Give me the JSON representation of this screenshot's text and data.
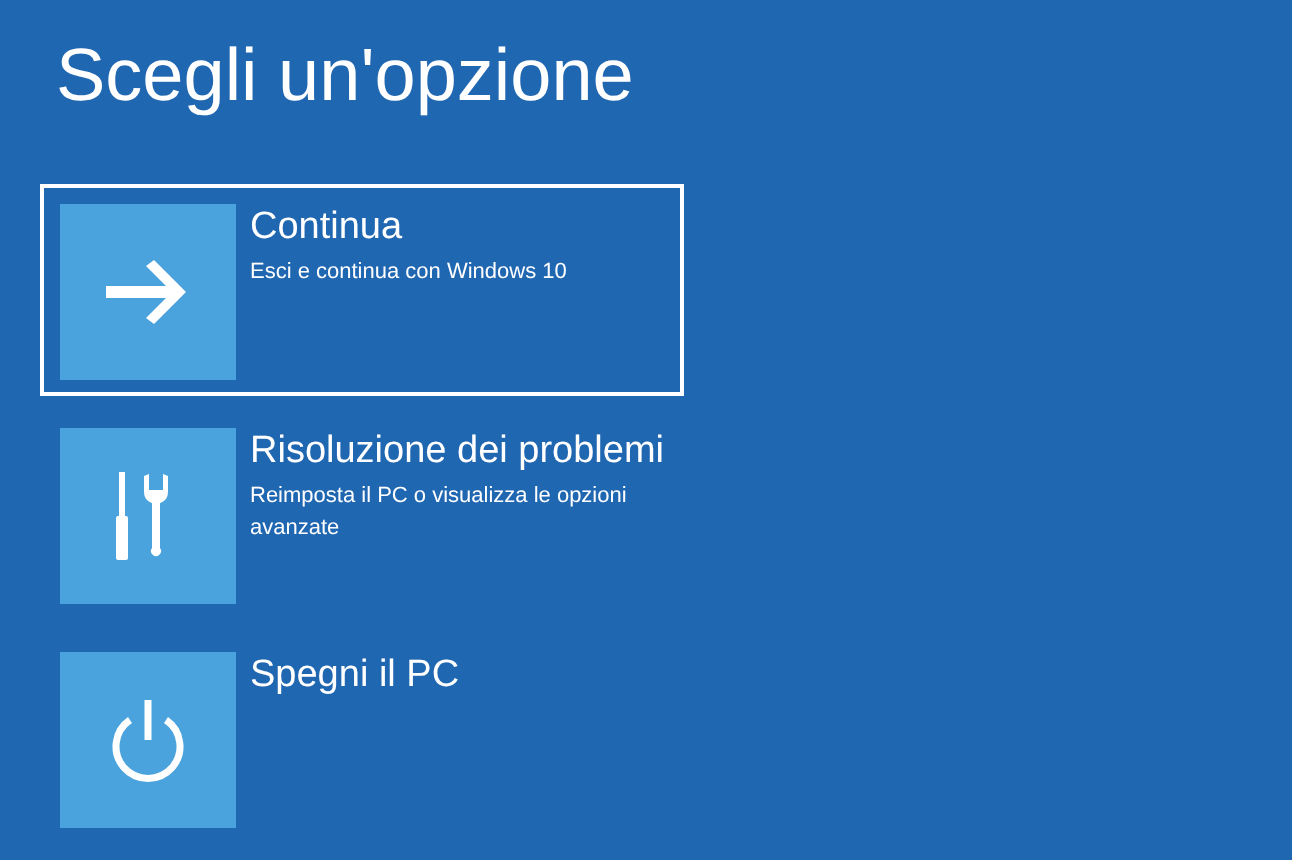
{
  "title": "Scegli un'opzione",
  "options": [
    {
      "kind": "arrow",
      "label": "Continua",
      "description": "Esci e continua con Windows 10",
      "selected": true
    },
    {
      "kind": "tools",
      "label": "Risoluzione dei problemi",
      "description": "Reimposta il PC o visualizza le opzioni avanzate",
      "selected": false
    },
    {
      "kind": "power",
      "label": "Spegni il PC",
      "selected": false
    }
  ]
}
